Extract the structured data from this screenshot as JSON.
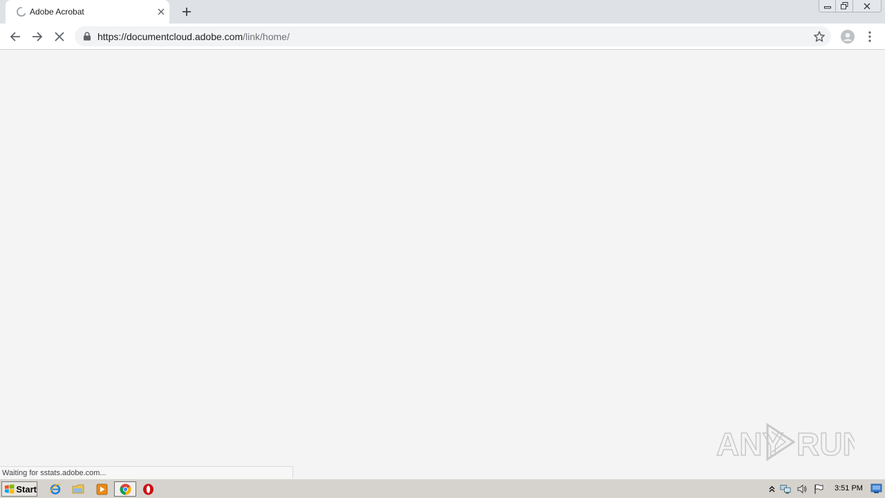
{
  "browser": {
    "tab": {
      "title": "Adobe Acrobat",
      "loading": true
    },
    "address": {
      "url_host": "https://documentcloud.adobe.com",
      "url_path": "/link/home/"
    },
    "status_text": "Waiting for sstats.adobe.com..."
  },
  "watermark": {
    "text": "ANY RUN"
  },
  "taskbar": {
    "start_label": "Start",
    "apps": [
      "internet-explorer",
      "file-explorer",
      "media-player",
      "chrome",
      "opera"
    ],
    "active_app": "chrome",
    "clock": "3:51 PM"
  },
  "colors": {
    "tabstrip": "#dee1e6",
    "page_background": "#f4f4f4",
    "taskbar": "#d6d3ce"
  }
}
